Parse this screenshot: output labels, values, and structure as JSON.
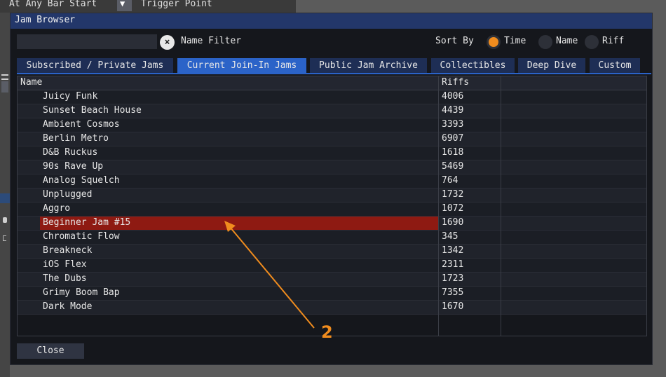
{
  "background": {
    "top_left_text": "At Any Bar Start",
    "dropdown_icon": "triangle-down-icon",
    "top_right_text": "Trigger Point"
  },
  "dialog": {
    "title": "Jam Browser",
    "filter": {
      "value": "",
      "placeholder": "",
      "clear_icon": "close-icon",
      "label": "Name Filter"
    },
    "sort": {
      "label": "Sort By",
      "options": [
        "Time",
        "Name",
        "Riff"
      ],
      "selected": "Time"
    },
    "tabs": [
      {
        "label": "Subscribed / Private Jams",
        "active": false
      },
      {
        "label": "Current Join-In Jams",
        "active": true
      },
      {
        "label": "Public Jam Archive",
        "active": false
      },
      {
        "label": "Collectibles",
        "active": false
      },
      {
        "label": "Deep Dive",
        "active": false
      },
      {
        "label": "Custom",
        "active": false
      }
    ],
    "table": {
      "columns": [
        "Name",
        "Riffs",
        ""
      ],
      "rows": [
        {
          "name": "Juicy Funk",
          "riffs": "4006"
        },
        {
          "name": "Sunset Beach House",
          "riffs": "4439"
        },
        {
          "name": "Ambient Cosmos",
          "riffs": "3393"
        },
        {
          "name": "Berlin Metro",
          "riffs": "6907"
        },
        {
          "name": "D&B Ruckus",
          "riffs": "1618"
        },
        {
          "name": "90s Rave Up",
          "riffs": "5469"
        },
        {
          "name": "Analog Squelch",
          "riffs": "764"
        },
        {
          "name": "Unplugged",
          "riffs": "1732"
        },
        {
          "name": "Aggro",
          "riffs": "1072"
        },
        {
          "name": "Beginner Jam #15",
          "riffs": "1690"
        },
        {
          "name": "Chromatic Flow",
          "riffs": "345"
        },
        {
          "name": "Breakneck",
          "riffs": "1342"
        },
        {
          "name": "iOS Flex",
          "riffs": "2311"
        },
        {
          "name": "The Dubs",
          "riffs": "1723"
        },
        {
          "name": "Grimy Boom Bap",
          "riffs": "7355"
        },
        {
          "name": "Dark Mode",
          "riffs": "1670"
        }
      ],
      "selected_row": "Beginner Jam #15"
    },
    "close_label": "Close"
  },
  "annotation": {
    "label": "2",
    "color": "#f08c1e"
  },
  "colors": {
    "accent_blue": "#2b63c8",
    "tab_inactive": "#1e2e55",
    "selection_red": "#8e1a12",
    "radio_orange": "#f08c1e"
  }
}
